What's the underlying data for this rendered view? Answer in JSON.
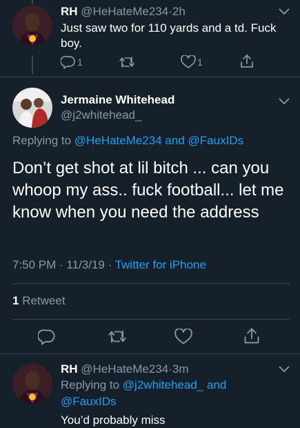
{
  "tweet1": {
    "name": "RH",
    "handle": "@HeHateMe234",
    "separator": "·",
    "time": "2h",
    "text": "Just saw two for 110 yards and a td. Fuck boy.",
    "reply_count": "1",
    "like_count": "1"
  },
  "tweet2": {
    "name": "Jermaine Whitehead",
    "handle": "@j2whitehead_",
    "replying_prefix": "Replying to",
    "replying_to_1": "@HeHateMe234",
    "replying_and": "and",
    "replying_to_2": "@FauxIDs",
    "body": "Don’t get shot at lil bitch ... can you whoop my ass.. fuck football... let me know when you need the address",
    "timestamp": "7:50 PM · 11/3/19 ·",
    "source": "Twitter for iPhone",
    "retweet_count": "1",
    "retweet_label": "Retweet"
  },
  "tweet3": {
    "name": "RH",
    "handle": "@HeHateMe234",
    "separator": "·",
    "time": "3m",
    "replying_prefix": "Replying to",
    "replying_to_1": "@j2whitehead_",
    "replying_and": "and",
    "replying_to_2": "@FauxIDs",
    "text": "You’d probably miss"
  },
  "colors": {
    "background": "#15202b",
    "muted": "#8899a6",
    "link": "#1da1f2",
    "divider": "#38444d",
    "text": "#ffffff"
  },
  "icons": [
    "reply-icon",
    "retweet-icon",
    "like-icon",
    "share-icon",
    "chevron-down-icon"
  ]
}
